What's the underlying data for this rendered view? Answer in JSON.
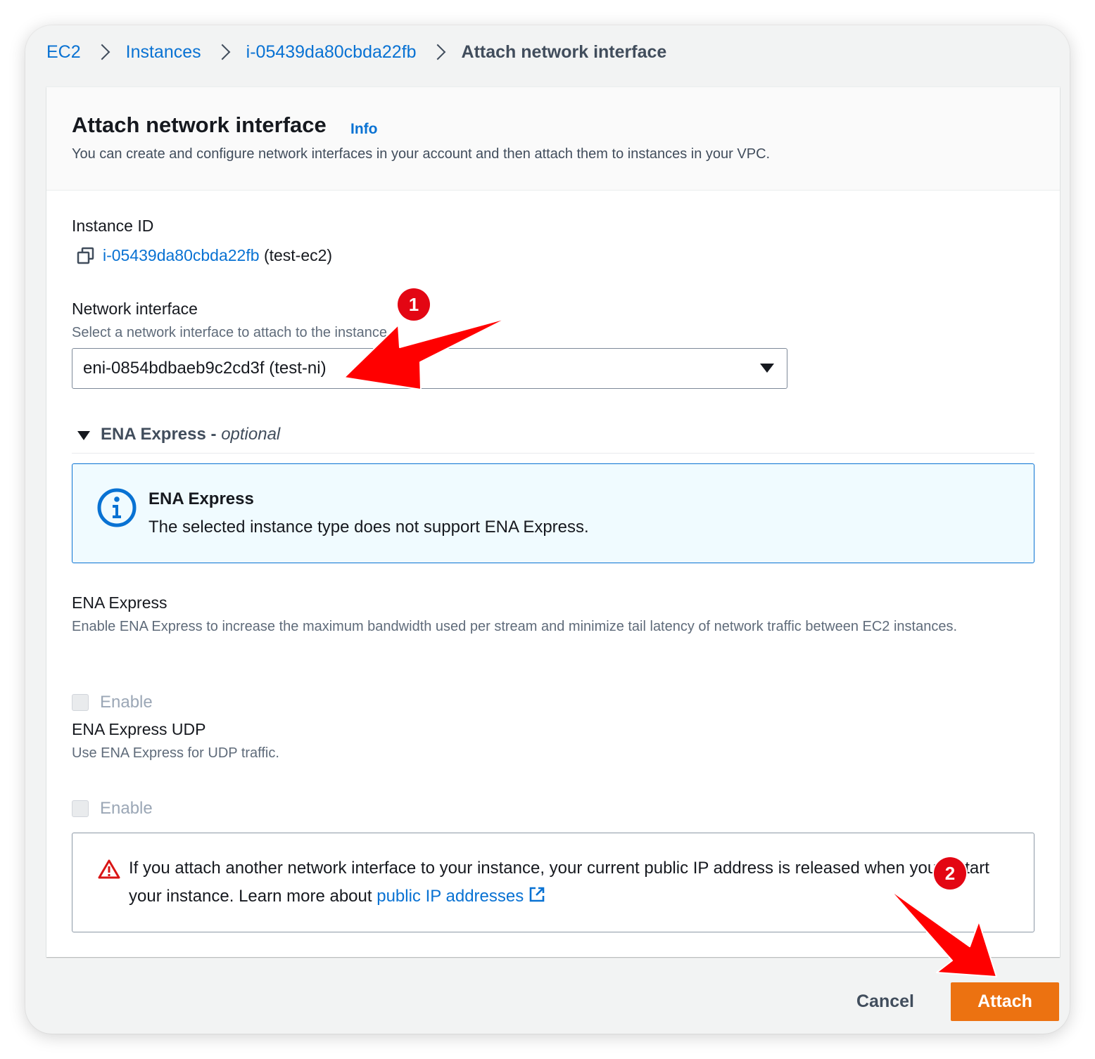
{
  "breadcrumb": {
    "items": [
      "EC2",
      "Instances",
      "i-05439da80cbda22fb"
    ],
    "current": "Attach network interface"
  },
  "header": {
    "title": "Attach network interface",
    "info_label": "Info",
    "description": "You can create and configure network interfaces in your account and then attach them to instances in your VPC."
  },
  "instance": {
    "label": "Instance ID",
    "id": "i-05439da80cbda22fb",
    "name_suffix": "(test-ec2)"
  },
  "network_interface": {
    "label": "Network interface",
    "description": "Select a network interface to attach to the instance",
    "selected": "eni-0854bdbaeb9c2cd3f (test-ni)"
  },
  "ena_section": {
    "title": "ENA Express -",
    "optional": "optional",
    "info_title": "ENA Express",
    "info_text": "The selected instance type does not support ENA Express."
  },
  "ena_express": {
    "label": "ENA Express",
    "description": "Enable ENA Express to increase the maximum bandwidth used per stream and minimize tail latency of network traffic between EC2 instances.",
    "checkbox_label": "Enable"
  },
  "ena_udp": {
    "label": "ENA Express UDP",
    "description": "Use ENA Express for UDP traffic.",
    "checkbox_label": "Enable"
  },
  "alert": {
    "text": "If you attach another network interface to your instance, your current public IP address is released when you restart your instance. Learn more about",
    "link": "public IP addresses"
  },
  "footer": {
    "cancel_label": "Cancel",
    "attach_label": "Attach"
  },
  "annotations": {
    "badge_1": "1",
    "badge_2": "2",
    "color": "#e30613"
  },
  "colors": {
    "link": "#0972d3",
    "primary_button": "#ec7211",
    "info_background": "#f0fbff"
  }
}
